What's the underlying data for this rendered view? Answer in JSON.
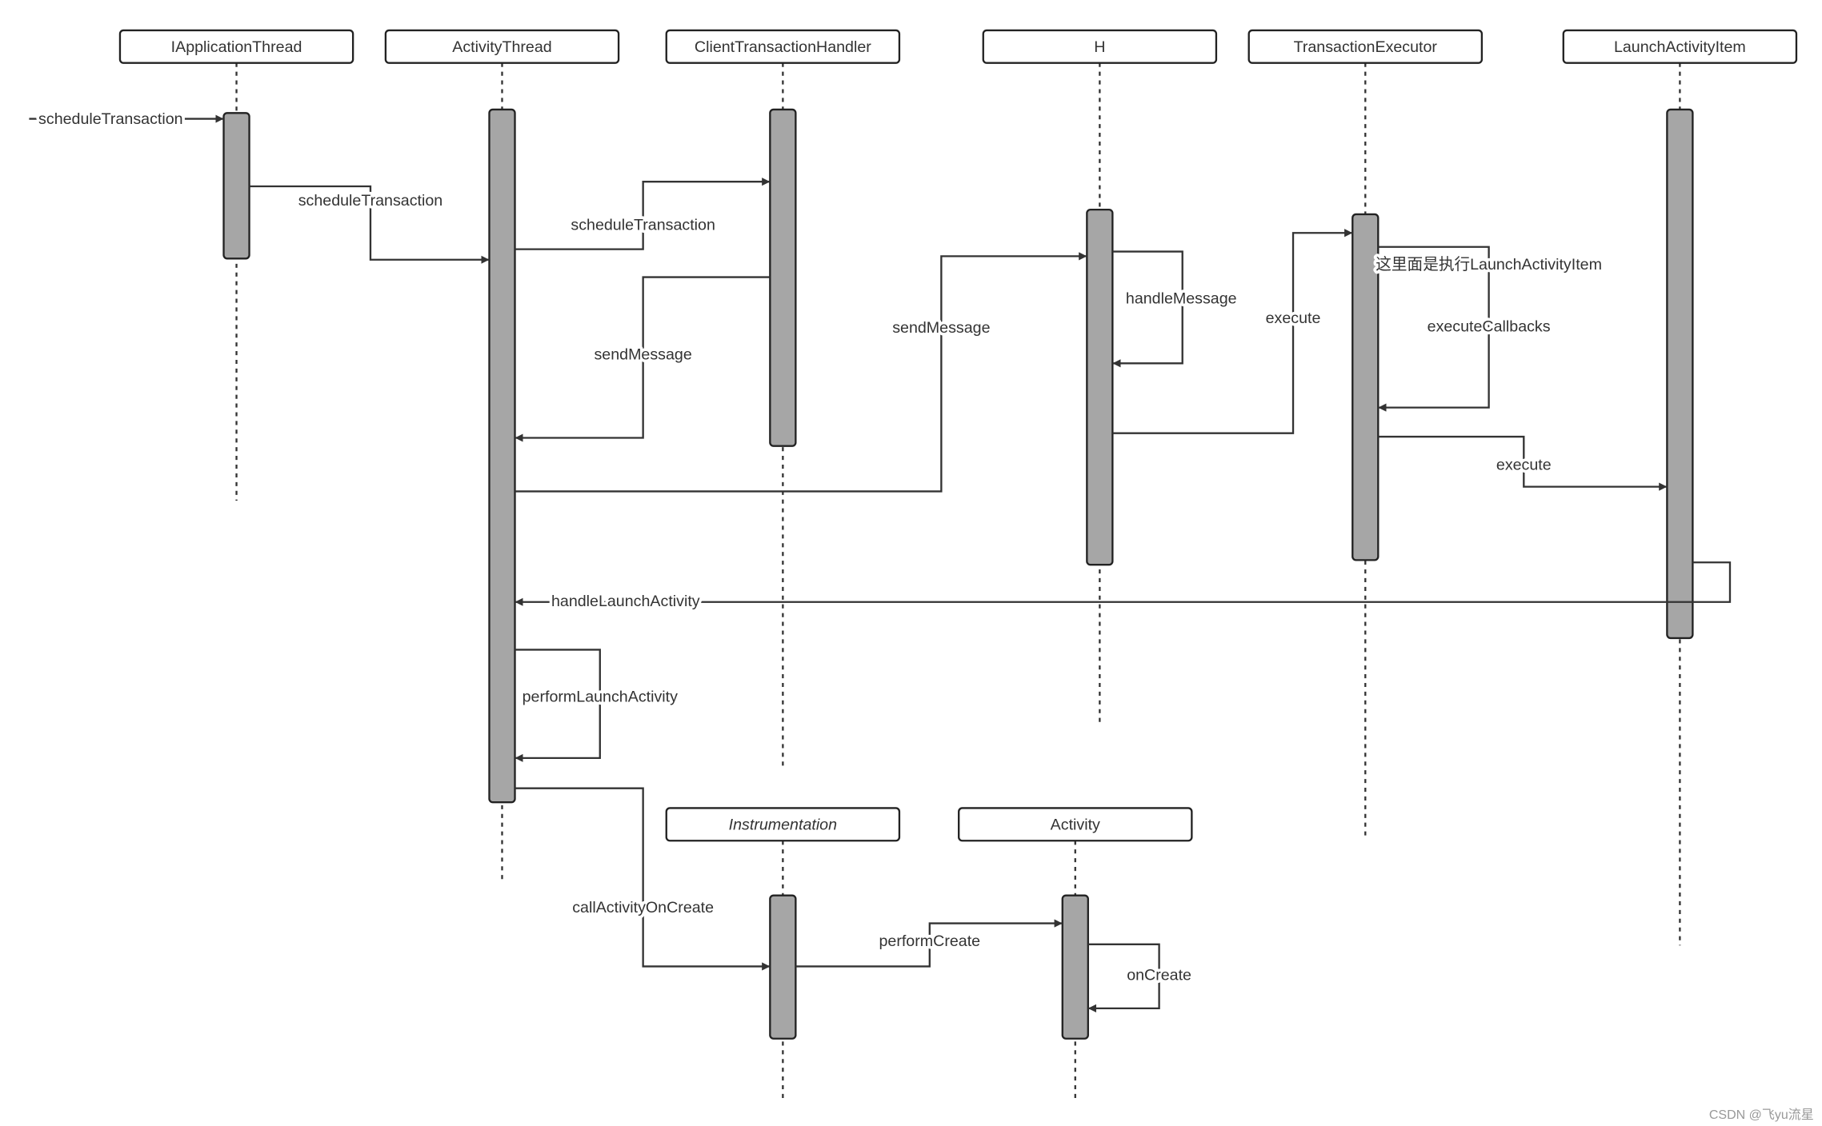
{
  "participants": {
    "iapplication_thread": "IApplicationThread",
    "activity_thread": "ActivityThread",
    "client_transaction_handler": "ClientTransactionHandler",
    "h": "H",
    "transaction_executor": "TransactionExecutor",
    "launch_activity_item": "LaunchActivityItem",
    "instrumentation": "Instrumentation",
    "activity": "Activity"
  },
  "messages": [
    {
      "label": "scheduleTransaction",
      "from": "",
      "to": "IApplicationThread"
    },
    {
      "label": "scheduleTransaction",
      "from": "IApplicationThread",
      "to": "ActivityThread"
    },
    {
      "label": "scheduleTransaction",
      "from": "ActivityThread",
      "to": "ClientTransactionHandler"
    },
    {
      "label": "sendMessage",
      "from": "ClientTransactionHandler",
      "to": "ActivityThread"
    },
    {
      "label": "sendMessage",
      "from": "ActivityThread",
      "to": "H"
    },
    {
      "label": "handleMessage",
      "from": "H",
      "to": "H"
    },
    {
      "label": "execute",
      "from": "H",
      "to": "TransactionExecutor"
    },
    {
      "label": "executeCallbacks",
      "note": "这里面是执行LaunchActivityItem",
      "from": "TransactionExecutor",
      "to": "TransactionExecutor"
    },
    {
      "label": "execute",
      "from": "TransactionExecutor",
      "to": "LaunchActivityItem"
    },
    {
      "label": "handleLaunchActivity",
      "from": "LaunchActivityItem",
      "to": "ActivityThread"
    },
    {
      "label": "performLaunchActivity",
      "from": "ActivityThread",
      "to": "ActivityThread"
    },
    {
      "label": "callActivityOnCreate",
      "from": "ActivityThread",
      "to": "Instrumentation"
    },
    {
      "label": "performCreate",
      "from": "Instrumentation",
      "to": "Activity"
    },
    {
      "label": "onCreate",
      "from": "Activity",
      "to": "Activity"
    }
  ],
  "watermark": "CSDN @飞yu流星",
  "colors": {
    "activation": "#a6a6a6",
    "line": "#333333"
  }
}
